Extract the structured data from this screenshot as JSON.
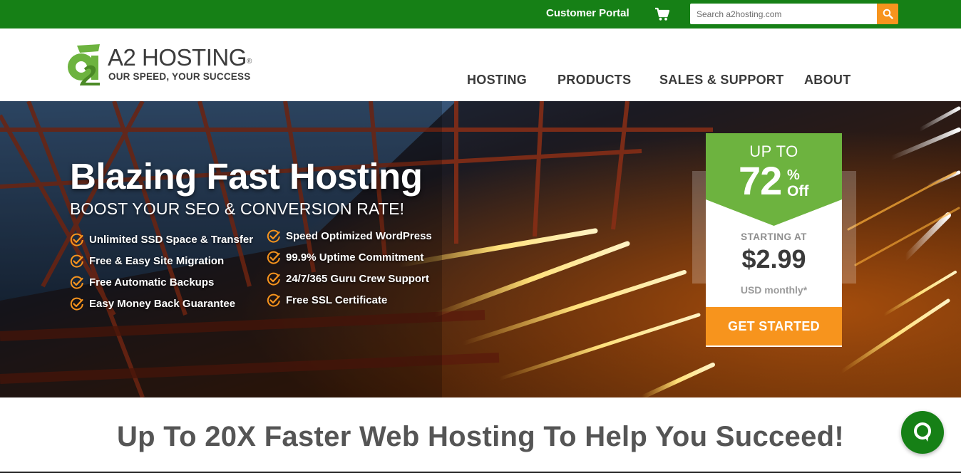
{
  "topbar": {
    "customer_portal": "Customer Portal",
    "cart_icon": "shopping-cart-icon",
    "search_placeholder": "Search a2hosting.com",
    "search_icon": "search-icon",
    "bg_color": "#168016",
    "accent_color": "#f7941d"
  },
  "logo": {
    "name": "A2 HOSTING",
    "registered": "®",
    "tagline": "OUR SPEED, YOUR SUCCESS",
    "mark": "a2-logo-icon"
  },
  "nav": {
    "hosting": "HOSTING",
    "products": "PRODUCTS",
    "sales_support": "SALES & SUPPORT",
    "about": "ABOUT"
  },
  "hero": {
    "title": "Blazing Fast Hosting",
    "subtitle": "BOOST YOUR SEO & CONVERSION RATE!",
    "check_icon": "check-circle-icon",
    "features_left": [
      "Unlimited SSD Space & Transfer",
      "Free & Easy Site Migration",
      "Free Automatic Backups",
      "Easy Money Back Guarantee"
    ],
    "features_right": [
      "Speed Optimized WordPress",
      "99.9% Uptime Commitment",
      "24/7/365 Guru Crew Support",
      "Free SSL Certificate"
    ]
  },
  "promo": {
    "up_to": "UP TO",
    "percent": "72",
    "percent_sign": "%",
    "off": "Off",
    "starting_at": "STARTING AT",
    "price": "$2.99",
    "unit": "USD monthly*",
    "cta": "GET STARTED",
    "badge_color": "#6db33f"
  },
  "section": {
    "headline": "Up To 20X Faster Web Hosting To Help You Succeed!"
  },
  "chat": {
    "icon": "chat-bubble-icon"
  }
}
